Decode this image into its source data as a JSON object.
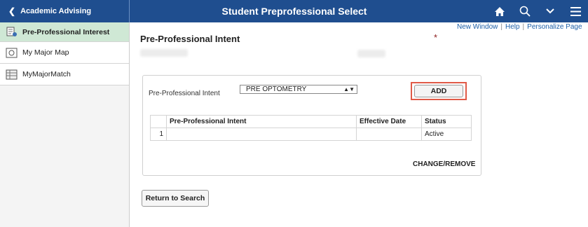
{
  "header": {
    "back_label": "Academic Advising",
    "title": "Student Preprofessional Select",
    "icons": [
      "home-icon",
      "search-icon",
      "chevron-down-icon",
      "menu-icon"
    ]
  },
  "sidebar": {
    "items": [
      {
        "label": "Pre-Professional Interest",
        "icon": "document-icon",
        "active": true
      },
      {
        "label": "My Major Map",
        "icon": "map-icon",
        "active": false
      },
      {
        "label": "MyMajorMatch",
        "icon": "grid-icon",
        "active": false
      }
    ]
  },
  "links": {
    "new_window": "New Window",
    "help": "Help",
    "personalize": "Personalize Page"
  },
  "main": {
    "title": "Pre-Professional Intent",
    "required_marker": "*",
    "intent_label": "Pre-Professional Intent",
    "intent_value": "PRE OPTOMETRY",
    "add_label": "ADD",
    "table": {
      "headers": [
        "Pre-Professional Intent",
        "Effective Date",
        "Status"
      ],
      "rows": [
        {
          "num": "1",
          "intent": "",
          "date": "",
          "status": "Active"
        }
      ]
    },
    "change_label": "CHANGE/REMOVE",
    "return_label": "Return to Search"
  },
  "colors": {
    "header_bg": "#1f4e8f",
    "sidebar_active": "#cfe8d5",
    "highlight": "#e05a47",
    "link": "#1d5fa8"
  }
}
